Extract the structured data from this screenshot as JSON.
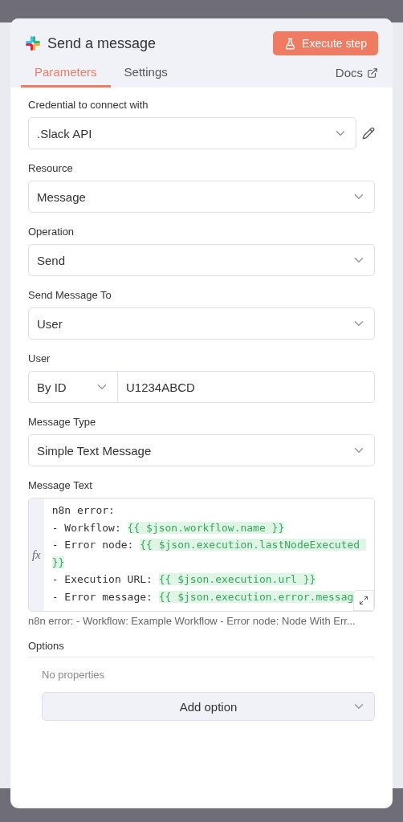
{
  "header": {
    "title": "Send a message",
    "execute_button": "Execute step"
  },
  "tabs": [
    {
      "label": "Parameters",
      "selected": true
    },
    {
      "label": "Settings",
      "selected": false
    }
  ],
  "docs_link": "Docs",
  "fields": [
    {
      "kind": "select",
      "label": "Credential to connect with",
      "value": ".Slack API",
      "editable": true
    },
    {
      "kind": "select",
      "label": "Resource",
      "value": "Message"
    },
    {
      "kind": "select",
      "label": "Operation",
      "value": "Send"
    },
    {
      "kind": "select",
      "label": "Send Message To",
      "value": "User"
    },
    {
      "kind": "combo",
      "label": "User",
      "mode": "By ID",
      "value": "U1234ABCD"
    },
    {
      "kind": "select",
      "label": "Message Type",
      "value": "Simple Text Message"
    },
    {
      "kind": "code",
      "label": "Message Text",
      "fx_label": "fx",
      "lines": [
        [
          {
            "kind": "plain",
            "text": "n8n error:"
          }
        ],
        [
          {
            "kind": "plain",
            "text": "- Workflow: "
          },
          {
            "kind": "expr",
            "text": "{{ $json.workflow.name }}"
          }
        ],
        [
          {
            "kind": "plain",
            "text": "- Error node: "
          },
          {
            "kind": "expr",
            "text": "{{ $json.execution.lastNodeExecuted "
          }
        ],
        [
          {
            "kind": "expr",
            "text": "}}"
          }
        ],
        [
          {
            "kind": "plain",
            "text": "- Execution URL: "
          },
          {
            "kind": "expr",
            "text": "{{ $json.execution.url }}"
          }
        ],
        [
          {
            "kind": "plain",
            "text": "- Error message: "
          },
          {
            "kind": "expr",
            "text": "{{ $json.execution.error.messag"
          }
        ]
      ],
      "preview": "n8n error: - Workflow: Example Workflow - Error node: Node With Err..."
    }
  ],
  "options": {
    "title": "Options",
    "empty_text": "No properties",
    "add_button": "Add option"
  }
}
